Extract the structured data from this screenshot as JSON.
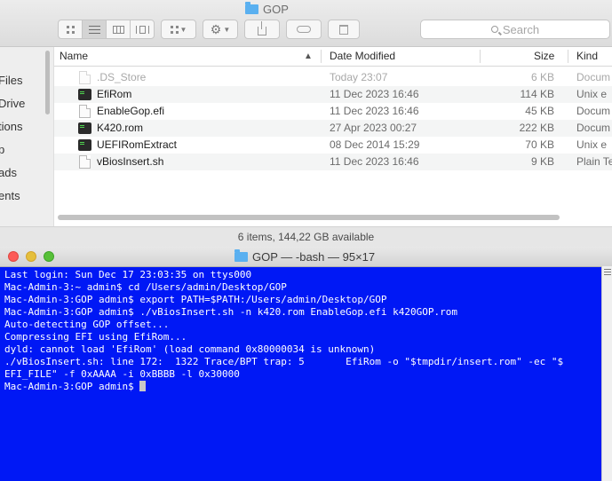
{
  "finder": {
    "title": "GOP",
    "search_placeholder": "Search",
    "sidebar_items": [
      "Files",
      "Drive",
      "tions",
      "p",
      "ads",
      "ents"
    ],
    "columns": {
      "name": "Name",
      "date": "Date Modified",
      "size": "Size",
      "kind": "Kind"
    },
    "files": [
      {
        "name": ".DS_Store",
        "date": "Today 23:07",
        "size": "6 KB",
        "kind": "Docum",
        "icon": "document-icon"
      },
      {
        "name": "EfiRom",
        "date": "11 Dec 2023 16:46",
        "size": "114 KB",
        "kind": "Unix e",
        "icon": "executable-icon"
      },
      {
        "name": "EnableGop.efi",
        "date": "11 Dec 2023 16:46",
        "size": "45 KB",
        "kind": "Docum",
        "icon": "document-icon"
      },
      {
        "name": "K420.rom",
        "date": "27 Apr 2023 00:27",
        "size": "222 KB",
        "kind": "Docum",
        "icon": "executable-icon"
      },
      {
        "name": "UEFIRomExtract",
        "date": "08 Dec 2014 15:29",
        "size": "70 KB",
        "kind": "Unix e",
        "icon": "executable-icon"
      },
      {
        "name": "vBiosInsert.sh",
        "date": "11 Dec 2023 16:46",
        "size": "9 KB",
        "kind": "Plain Te",
        "icon": "document-icon"
      }
    ],
    "status": "6 items, 144,22 GB available"
  },
  "terminal": {
    "title": "GOP — -bash — 95×17",
    "background_color": "#0018f5",
    "lines": [
      "Last login: Sun Dec 17 23:03:35 on ttys000",
      "Mac-Admin-3:~ admin$ cd /Users/admin/Desktop/GOP",
      "Mac-Admin-3:GOP admin$ export PATH=$PATH:/Users/admin/Desktop/GOP",
      "Mac-Admin-3:GOP admin$ ./vBiosInsert.sh -n k420.rom EnableGop.efi k420GOP.rom",
      "Auto-detecting GOP offset...",
      "Compressing EFI using EfiRom...",
      "dyld: cannot load 'EfiRom' (load command 0x80000034 is unknown)",
      "./vBiosInsert.sh: line 172:  1322 Trace/BPT trap: 5       EfiRom -o \"$tmpdir/insert.rom\" -ec \"$",
      "EFI_FILE\" -f 0xAAAA -i 0xBBBB -l 0x30000"
    ],
    "prompt": "Mac-Admin-3:GOP admin$ "
  }
}
